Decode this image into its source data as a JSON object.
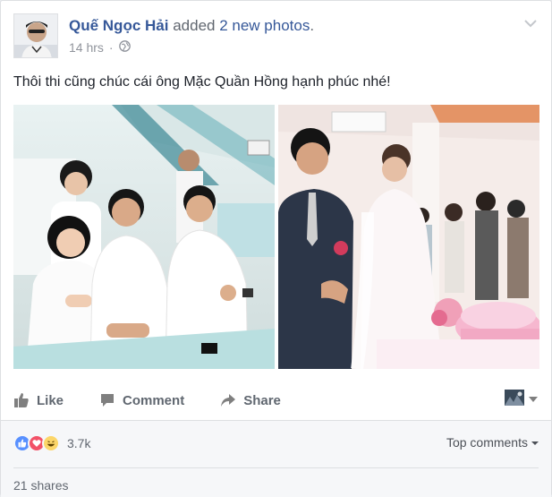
{
  "post": {
    "author": "Quế Ngọc Hải",
    "action_prefix": "added ",
    "action_link": "2 new photos",
    "action_suffix": ".",
    "time": "14 hrs",
    "separator": "·",
    "text": "Thôi thi cũng chúc cái ông Mặc Quần Hồng hạnh phúc nhé!"
  },
  "actions": {
    "like": "Like",
    "comment": "Comment",
    "share": "Share"
  },
  "reactions": {
    "count": "3.7k",
    "top_comments": "Top comments",
    "shares": "21 shares",
    "icons": [
      "like-icon",
      "love-icon",
      "haha-icon"
    ]
  },
  "colors": {
    "link": "#365899",
    "muted": "#90949c",
    "action": "#606770",
    "like_blue": "#5890ff",
    "love_red": "#f25268",
    "haha_yellow": "#fcd669"
  }
}
